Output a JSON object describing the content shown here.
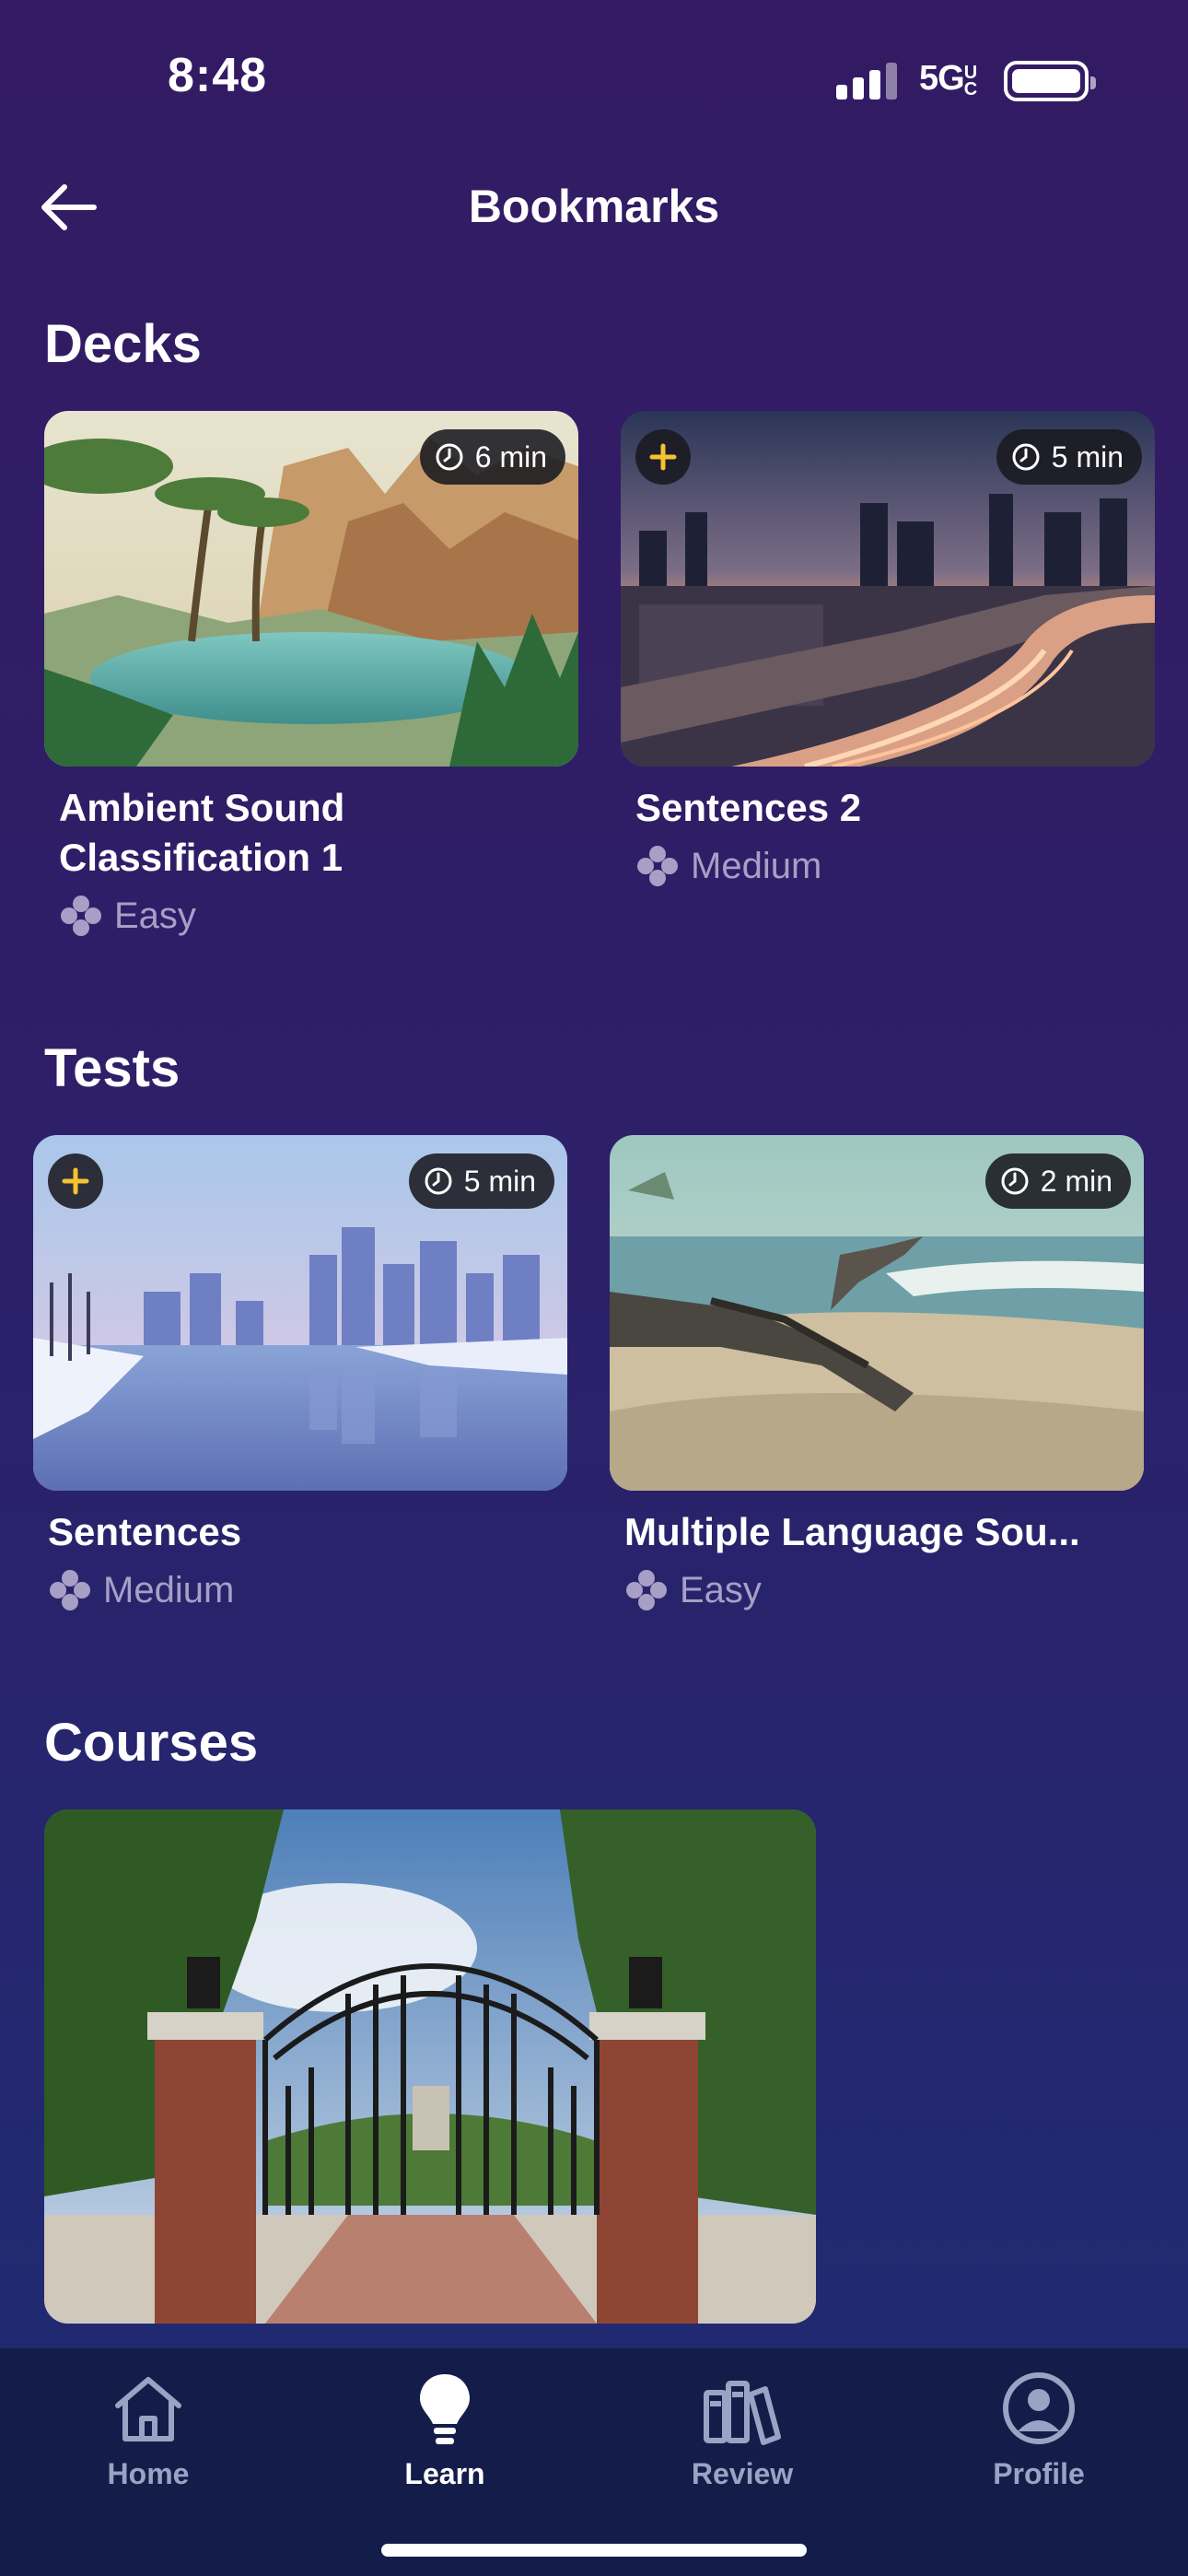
{
  "status_bar": {
    "time": "8:48",
    "network": "5G",
    "network_suffix": "UC"
  },
  "header": {
    "title": "Bookmarks",
    "back_icon": "arrow-left-icon"
  },
  "sections": {
    "decks": {
      "title": "Decks",
      "cards": [
        {
          "title_line1": "Ambient Sound",
          "title_line2": "Classification 1",
          "duration": "6 min",
          "difficulty": "Easy",
          "bookmarked_plus": false
        },
        {
          "title_line1": "Sentences 2",
          "title_line2": "",
          "duration": "5 min",
          "difficulty": "Medium",
          "bookmarked_plus": true
        }
      ]
    },
    "tests": {
      "title": "Tests",
      "cards": [
        {
          "title": "Sentences",
          "duration": "5 min",
          "difficulty": "Medium",
          "bookmarked_plus": true
        },
        {
          "title": "Multiple Language Sou...",
          "duration": "2 min",
          "difficulty": "Easy",
          "bookmarked_plus": false
        }
      ]
    },
    "courses": {
      "title": "Courses"
    }
  },
  "tab_bar": {
    "items": [
      {
        "label": "Home",
        "icon": "house-icon",
        "active": false
      },
      {
        "label": "Learn",
        "icon": "lightbulb-icon",
        "active": true
      },
      {
        "label": "Review",
        "icon": "books-icon",
        "active": false
      },
      {
        "label": "Profile",
        "icon": "user-circle-icon",
        "active": false
      }
    ]
  },
  "colors": {
    "accent_plus": "#f5c230",
    "muted_text": "#a89fc7",
    "tab_inactive": "#9ba3c4"
  }
}
